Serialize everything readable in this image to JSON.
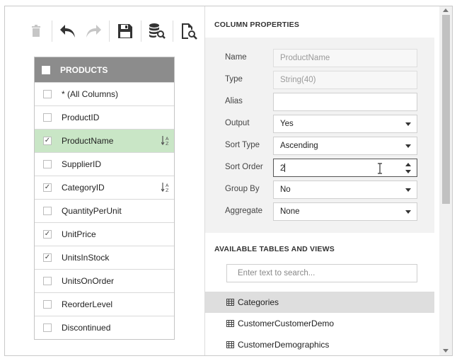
{
  "toolbar": {
    "buttons": [
      {
        "icon": "trash-icon",
        "enabled": false
      },
      {
        "icon": "undo-icon",
        "enabled": true
      },
      {
        "icon": "redo-icon",
        "enabled": false
      },
      {
        "icon": "save-icon",
        "enabled": true
      },
      {
        "icon": "database-search-icon",
        "enabled": true
      },
      {
        "icon": "document-search-icon",
        "enabled": true
      }
    ]
  },
  "products": {
    "title": "PRODUCTS",
    "rows": [
      {
        "label": "* (All Columns)",
        "checked": false,
        "sorted": false
      },
      {
        "label": "ProductID",
        "checked": false,
        "sorted": false
      },
      {
        "label": "ProductName",
        "checked": true,
        "sorted": true,
        "selected": true
      },
      {
        "label": "SupplierID",
        "checked": false,
        "sorted": false
      },
      {
        "label": "CategoryID",
        "checked": true,
        "sorted": true
      },
      {
        "label": "QuantityPerUnit",
        "checked": false,
        "sorted": false
      },
      {
        "label": "UnitPrice",
        "checked": true,
        "sorted": false
      },
      {
        "label": "UnitsInStock",
        "checked": true,
        "sorted": false
      },
      {
        "label": "UnitsOnOrder",
        "checked": false,
        "sorted": false
      },
      {
        "label": "ReorderLevel",
        "checked": false,
        "sorted": false
      },
      {
        "label": "Discontinued",
        "checked": false,
        "sorted": false
      }
    ]
  },
  "column_properties": {
    "title": "COLUMN PROPERTIES",
    "name": {
      "label": "Name",
      "value": "ProductName"
    },
    "type": {
      "label": "Type",
      "value": "String(40)"
    },
    "alias": {
      "label": "Alias",
      "value": ""
    },
    "output": {
      "label": "Output",
      "value": "Yes"
    },
    "sort_type": {
      "label": "Sort Type",
      "value": "Ascending"
    },
    "sort_order": {
      "label": "Sort Order",
      "value": "2"
    },
    "group_by": {
      "label": "Group By",
      "value": "No"
    },
    "aggregate": {
      "label": "Aggregate",
      "value": "None"
    }
  },
  "tables_views": {
    "title": "AVAILABLE TABLES AND VIEWS",
    "search_placeholder": "Enter text to search...",
    "items": [
      {
        "label": "Categories",
        "selected": true
      },
      {
        "label": "CustomerCustomerDemo",
        "selected": false
      },
      {
        "label": "CustomerDemographics",
        "selected": false
      }
    ]
  },
  "colors": {
    "selected_row": "#c9e6c6",
    "header_bg": "#8c8c8c",
    "panel_bg": "#f2f2f2"
  }
}
